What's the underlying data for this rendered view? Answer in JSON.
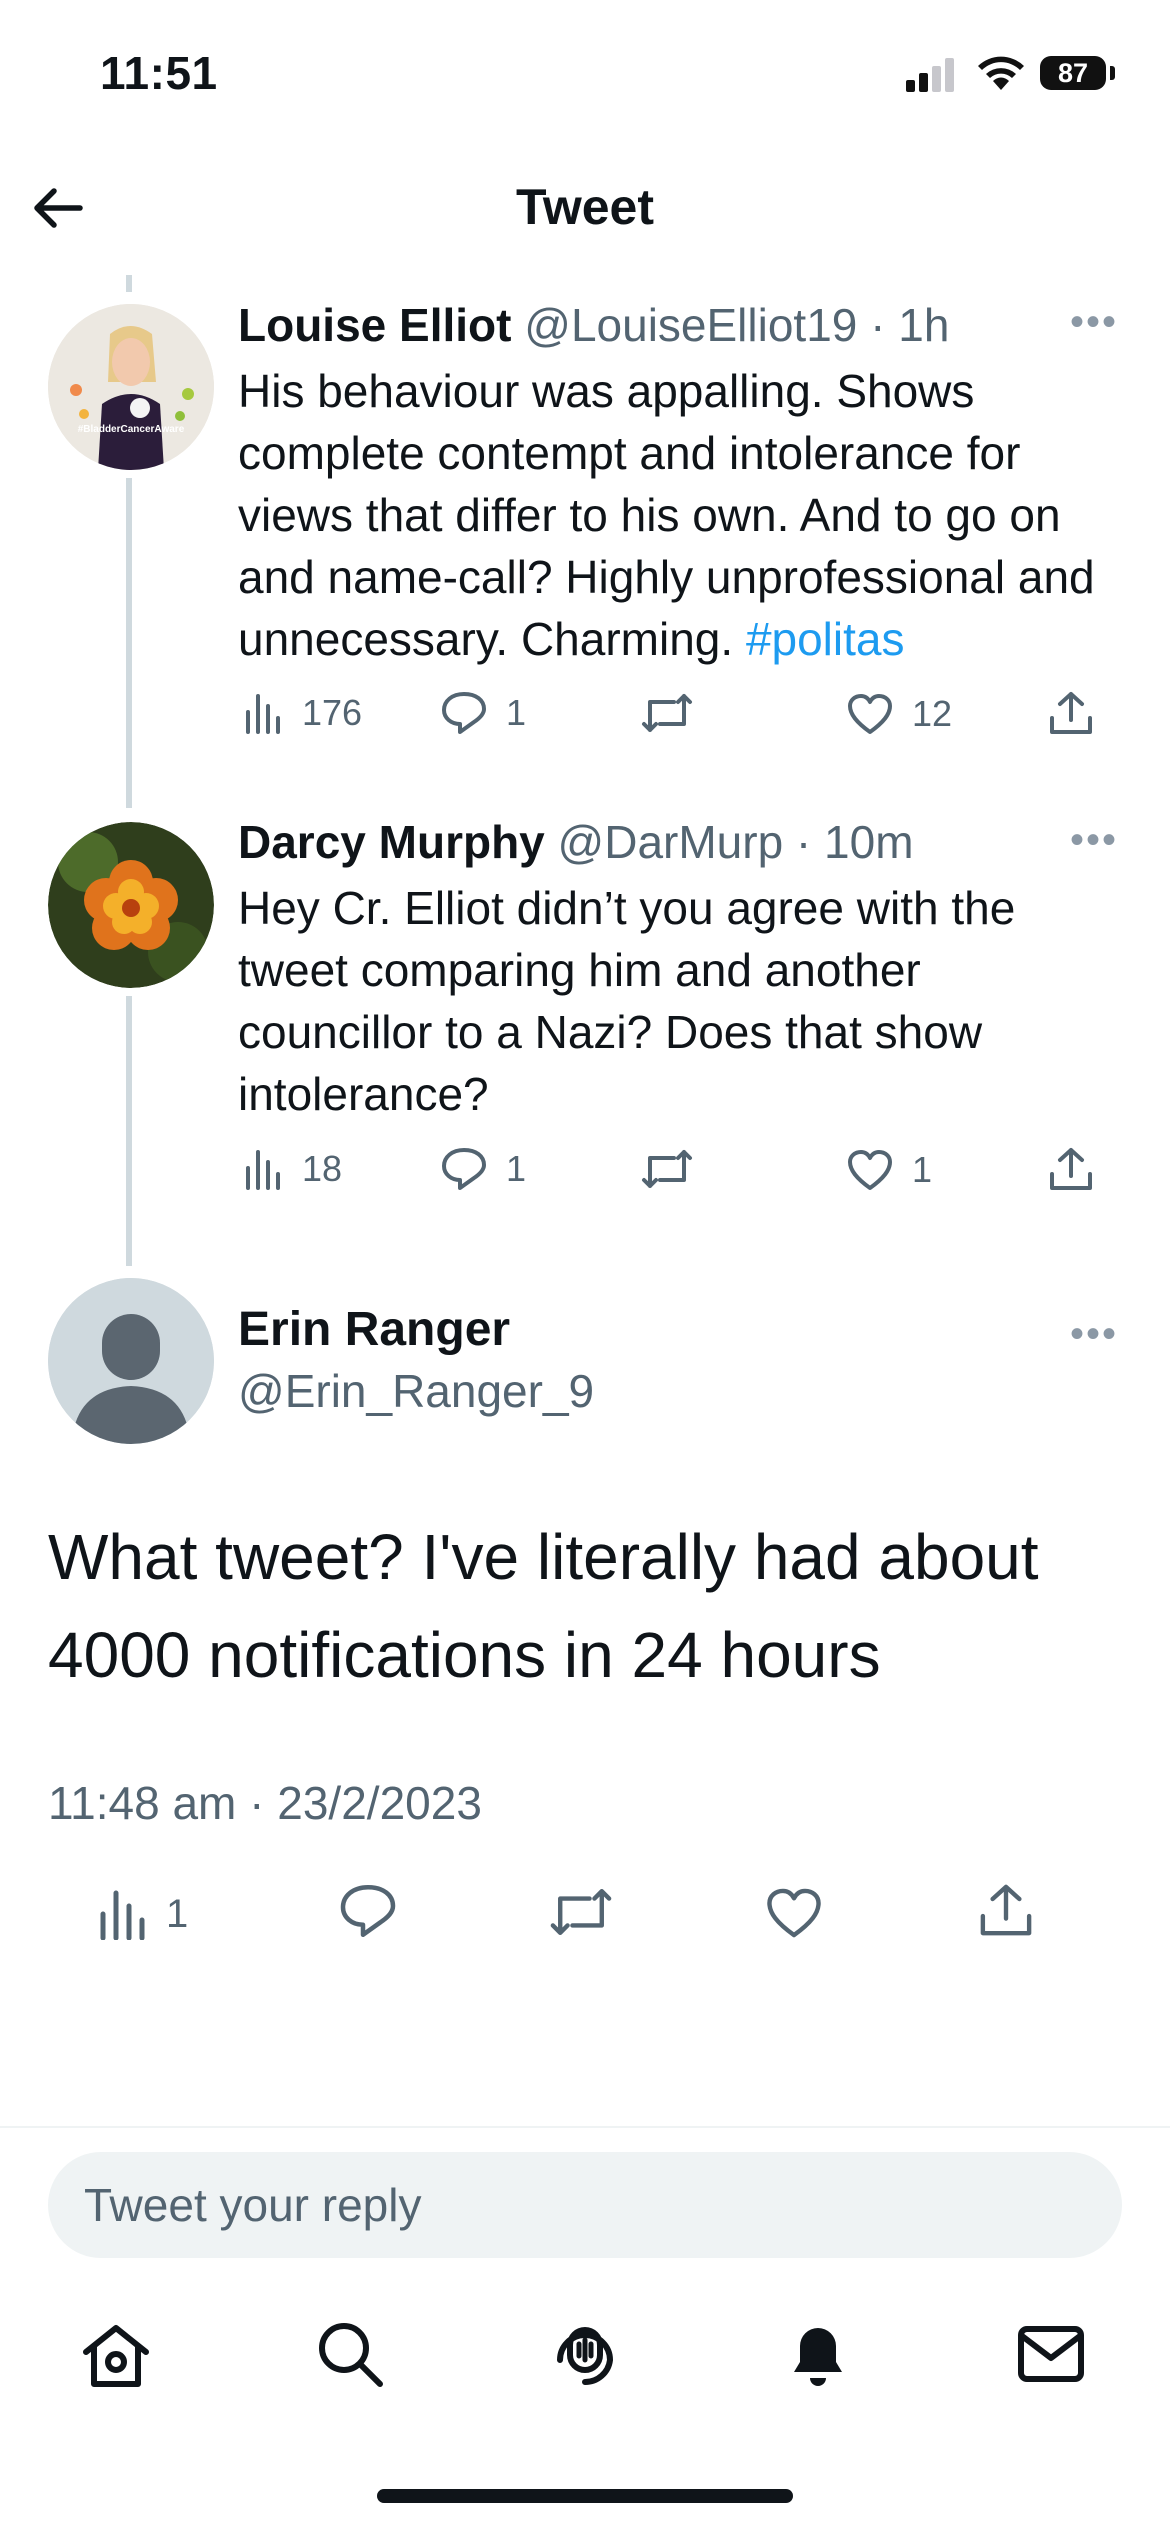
{
  "status_bar": {
    "time": "11:51",
    "battery": "87"
  },
  "header": {
    "title": "Tweet"
  },
  "thread": [
    {
      "name": "Louise Elliot",
      "handle": "@LouiseElliot19",
      "time": "1h",
      "avatar_text": "#BladderCancerAware",
      "text": "His behaviour was appalling. Shows complete contempt and intolerance for views that differ to his own. And to go on and name-call? Highly unprofessional and unnecessary. Charming.",
      "hashtag": "#politas",
      "views": "176",
      "replies": "1",
      "retweets": "",
      "likes": "12"
    },
    {
      "name": "Darcy Murphy",
      "handle": "@DarMurp",
      "time": "10m",
      "text": "Hey Cr. Elliot didn’t you agree with the tweet comparing him and another councillor to a Nazi? Does that show intolerance?",
      "views": "18",
      "replies": "1",
      "retweets": "",
      "likes": "1"
    }
  ],
  "main_tweet": {
    "name": "Erin Ranger",
    "handle": "@Erin_Ranger_9",
    "text": "What tweet? I've literally had about 4000 notifications in 24 hours",
    "timestamp": "11:48 am · 23/2/2023",
    "views": "1"
  },
  "reply": {
    "placeholder": "Tweet your reply"
  },
  "tabbar": {
    "items": [
      "home-icon",
      "search-icon",
      "spaces-icon",
      "notifications-icon",
      "messages-icon"
    ]
  },
  "colors": {
    "accent": "#1d9bf0",
    "secondary_text": "#536471",
    "thread_line": "#cfd9de"
  }
}
